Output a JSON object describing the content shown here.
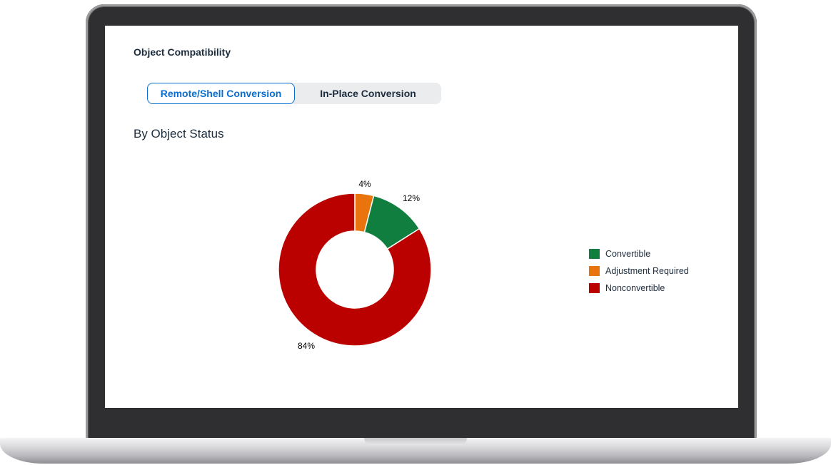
{
  "card": {
    "title": "Object Compatibility"
  },
  "segmented": {
    "options": [
      {
        "label": "Remote/Shell Conversion",
        "selected": true
      },
      {
        "label": "In-Place Conversion",
        "selected": false
      }
    ]
  },
  "section": {
    "title": "By Object Status"
  },
  "colors": {
    "accent": "#0a6ed1",
    "convertible": "#107e3e",
    "adjustment": "#e9730c",
    "nonconvertible": "#bb0000"
  },
  "chart_data": {
    "type": "pie",
    "donut": true,
    "categories": [
      "Adjustment Required",
      "Convertible",
      "Nonconvertible"
    ],
    "values": [
      4,
      12,
      84
    ],
    "labels": [
      "4%",
      "12%",
      "84%"
    ],
    "colors": [
      "#e9730c",
      "#107e3e",
      "#bb0000"
    ],
    "legend": {
      "placement": "right",
      "entries": [
        {
          "label": "Convertible",
          "color": "#107e3e"
        },
        {
          "label": "Adjustment Required",
          "color": "#e9730c"
        },
        {
          "label": "Nonconvertible",
          "color": "#bb0000"
        }
      ]
    }
  }
}
